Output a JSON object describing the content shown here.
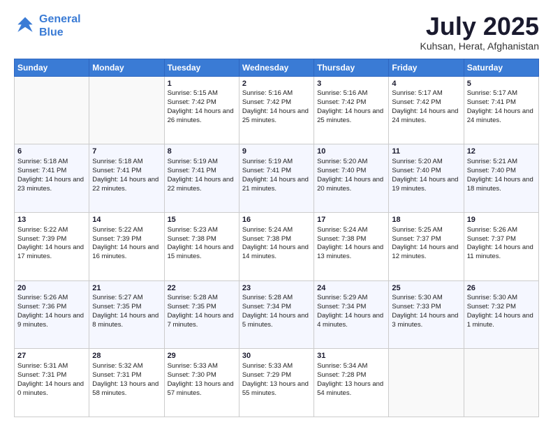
{
  "logo": {
    "line1": "General",
    "line2": "Blue"
  },
  "title": "July 2025",
  "location": "Kuhsan, Herat, Afghanistan",
  "days_of_week": [
    "Sunday",
    "Monday",
    "Tuesday",
    "Wednesday",
    "Thursday",
    "Friday",
    "Saturday"
  ],
  "weeks": [
    [
      {
        "day": "",
        "sunrise": "",
        "sunset": "",
        "daylight": "",
        "empty": true
      },
      {
        "day": "",
        "sunrise": "",
        "sunset": "",
        "daylight": "",
        "empty": true
      },
      {
        "day": "1",
        "sunrise": "Sunrise: 5:15 AM",
        "sunset": "Sunset: 7:42 PM",
        "daylight": "Daylight: 14 hours and 26 minutes."
      },
      {
        "day": "2",
        "sunrise": "Sunrise: 5:16 AM",
        "sunset": "Sunset: 7:42 PM",
        "daylight": "Daylight: 14 hours and 25 minutes."
      },
      {
        "day": "3",
        "sunrise": "Sunrise: 5:16 AM",
        "sunset": "Sunset: 7:42 PM",
        "daylight": "Daylight: 14 hours and 25 minutes."
      },
      {
        "day": "4",
        "sunrise": "Sunrise: 5:17 AM",
        "sunset": "Sunset: 7:42 PM",
        "daylight": "Daylight: 14 hours and 24 minutes."
      },
      {
        "day": "5",
        "sunrise": "Sunrise: 5:17 AM",
        "sunset": "Sunset: 7:41 PM",
        "daylight": "Daylight: 14 hours and 24 minutes."
      }
    ],
    [
      {
        "day": "6",
        "sunrise": "Sunrise: 5:18 AM",
        "sunset": "Sunset: 7:41 PM",
        "daylight": "Daylight: 14 hours and 23 minutes."
      },
      {
        "day": "7",
        "sunrise": "Sunrise: 5:18 AM",
        "sunset": "Sunset: 7:41 PM",
        "daylight": "Daylight: 14 hours and 22 minutes."
      },
      {
        "day": "8",
        "sunrise": "Sunrise: 5:19 AM",
        "sunset": "Sunset: 7:41 PM",
        "daylight": "Daylight: 14 hours and 22 minutes."
      },
      {
        "day": "9",
        "sunrise": "Sunrise: 5:19 AM",
        "sunset": "Sunset: 7:41 PM",
        "daylight": "Daylight: 14 hours and 21 minutes."
      },
      {
        "day": "10",
        "sunrise": "Sunrise: 5:20 AM",
        "sunset": "Sunset: 7:40 PM",
        "daylight": "Daylight: 14 hours and 20 minutes."
      },
      {
        "day": "11",
        "sunrise": "Sunrise: 5:20 AM",
        "sunset": "Sunset: 7:40 PM",
        "daylight": "Daylight: 14 hours and 19 minutes."
      },
      {
        "day": "12",
        "sunrise": "Sunrise: 5:21 AM",
        "sunset": "Sunset: 7:40 PM",
        "daylight": "Daylight: 14 hours and 18 minutes."
      }
    ],
    [
      {
        "day": "13",
        "sunrise": "Sunrise: 5:22 AM",
        "sunset": "Sunset: 7:39 PM",
        "daylight": "Daylight: 14 hours and 17 minutes."
      },
      {
        "day": "14",
        "sunrise": "Sunrise: 5:22 AM",
        "sunset": "Sunset: 7:39 PM",
        "daylight": "Daylight: 14 hours and 16 minutes."
      },
      {
        "day": "15",
        "sunrise": "Sunrise: 5:23 AM",
        "sunset": "Sunset: 7:38 PM",
        "daylight": "Daylight: 14 hours and 15 minutes."
      },
      {
        "day": "16",
        "sunrise": "Sunrise: 5:24 AM",
        "sunset": "Sunset: 7:38 PM",
        "daylight": "Daylight: 14 hours and 14 minutes."
      },
      {
        "day": "17",
        "sunrise": "Sunrise: 5:24 AM",
        "sunset": "Sunset: 7:38 PM",
        "daylight": "Daylight: 14 hours and 13 minutes."
      },
      {
        "day": "18",
        "sunrise": "Sunrise: 5:25 AM",
        "sunset": "Sunset: 7:37 PM",
        "daylight": "Daylight: 14 hours and 12 minutes."
      },
      {
        "day": "19",
        "sunrise": "Sunrise: 5:26 AM",
        "sunset": "Sunset: 7:37 PM",
        "daylight": "Daylight: 14 hours and 11 minutes."
      }
    ],
    [
      {
        "day": "20",
        "sunrise": "Sunrise: 5:26 AM",
        "sunset": "Sunset: 7:36 PM",
        "daylight": "Daylight: 14 hours and 9 minutes."
      },
      {
        "day": "21",
        "sunrise": "Sunrise: 5:27 AM",
        "sunset": "Sunset: 7:35 PM",
        "daylight": "Daylight: 14 hours and 8 minutes."
      },
      {
        "day": "22",
        "sunrise": "Sunrise: 5:28 AM",
        "sunset": "Sunset: 7:35 PM",
        "daylight": "Daylight: 14 hours and 7 minutes."
      },
      {
        "day": "23",
        "sunrise": "Sunrise: 5:28 AM",
        "sunset": "Sunset: 7:34 PM",
        "daylight": "Daylight: 14 hours and 5 minutes."
      },
      {
        "day": "24",
        "sunrise": "Sunrise: 5:29 AM",
        "sunset": "Sunset: 7:34 PM",
        "daylight": "Daylight: 14 hours and 4 minutes."
      },
      {
        "day": "25",
        "sunrise": "Sunrise: 5:30 AM",
        "sunset": "Sunset: 7:33 PM",
        "daylight": "Daylight: 14 hours and 3 minutes."
      },
      {
        "day": "26",
        "sunrise": "Sunrise: 5:30 AM",
        "sunset": "Sunset: 7:32 PM",
        "daylight": "Daylight: 14 hours and 1 minute."
      }
    ],
    [
      {
        "day": "27",
        "sunrise": "Sunrise: 5:31 AM",
        "sunset": "Sunset: 7:31 PM",
        "daylight": "Daylight: 14 hours and 0 minutes."
      },
      {
        "day": "28",
        "sunrise": "Sunrise: 5:32 AM",
        "sunset": "Sunset: 7:31 PM",
        "daylight": "Daylight: 13 hours and 58 minutes."
      },
      {
        "day": "29",
        "sunrise": "Sunrise: 5:33 AM",
        "sunset": "Sunset: 7:30 PM",
        "daylight": "Daylight: 13 hours and 57 minutes."
      },
      {
        "day": "30",
        "sunrise": "Sunrise: 5:33 AM",
        "sunset": "Sunset: 7:29 PM",
        "daylight": "Daylight: 13 hours and 55 minutes."
      },
      {
        "day": "31",
        "sunrise": "Sunrise: 5:34 AM",
        "sunset": "Sunset: 7:28 PM",
        "daylight": "Daylight: 13 hours and 54 minutes."
      },
      {
        "day": "",
        "sunrise": "",
        "sunset": "",
        "daylight": "",
        "empty": true
      },
      {
        "day": "",
        "sunrise": "",
        "sunset": "",
        "daylight": "",
        "empty": true
      }
    ]
  ]
}
